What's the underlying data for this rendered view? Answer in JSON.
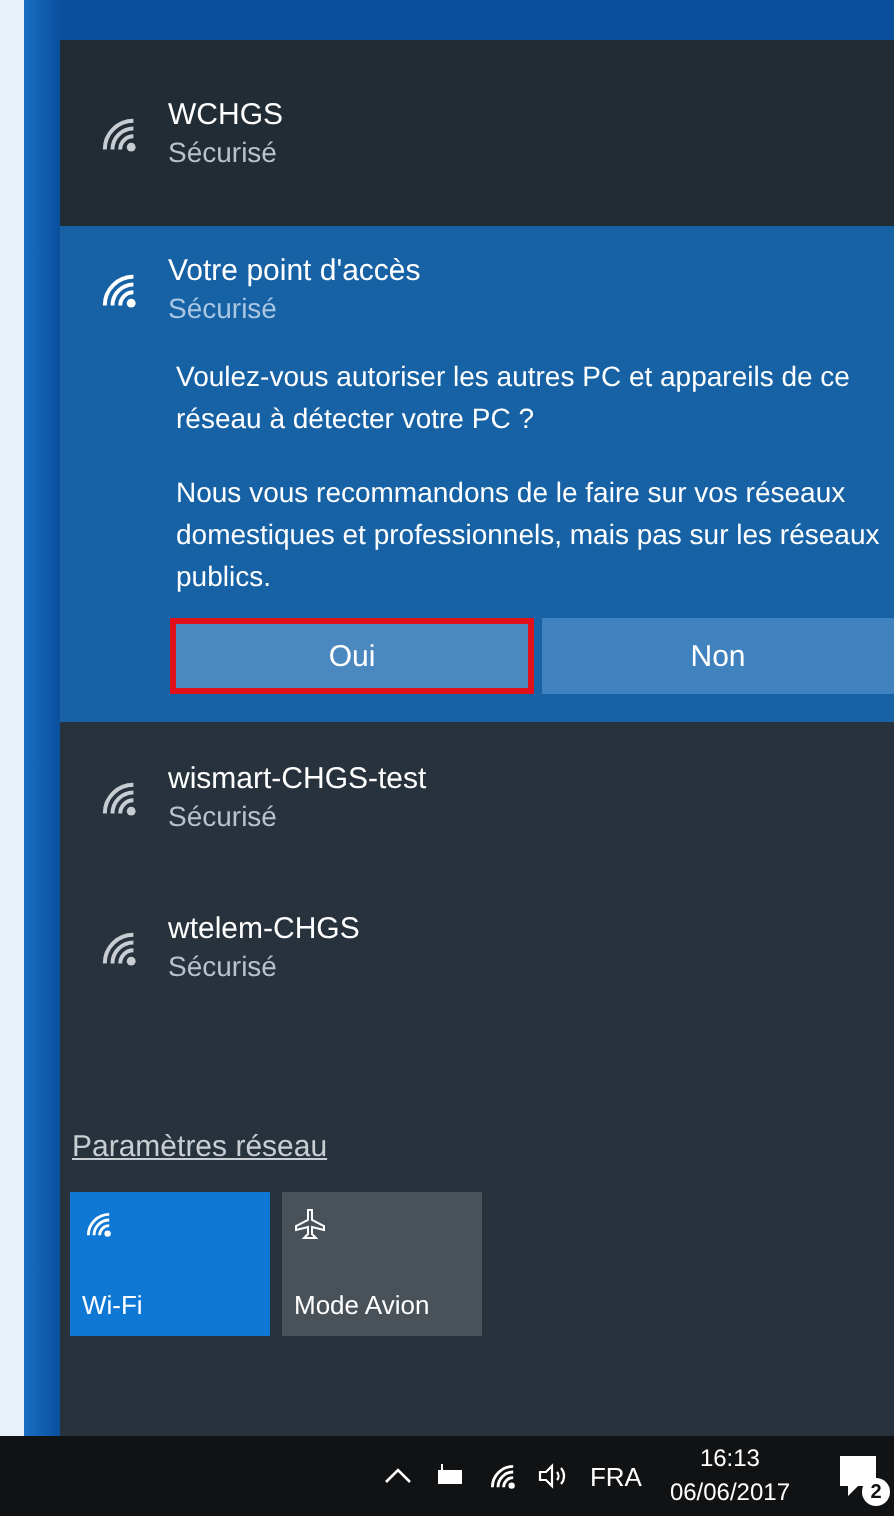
{
  "networks_top": [
    {
      "name": "WCHGS",
      "status": "Sécurisé",
      "selected": false
    }
  ],
  "selected_network": {
    "name": "Votre point d'accès",
    "status": "Sécurisé",
    "prompt": "Voulez-vous autoriser les autres PC et appareils de ce réseau à détecter votre PC ?",
    "advice": "Nous vous recommandons de le faire sur vos réseaux domestiques et professionnels, mais pas sur les réseaux publics.",
    "buttons": [
      {
        "label": "Oui",
        "highlighted": true
      },
      {
        "label": "Non",
        "highlighted": false
      }
    ]
  },
  "networks": [
    {
      "name": "wismart-CHGS-test",
      "status": "Sécurisé",
      "selected": false
    },
    {
      "name": "wtelem-CHGS",
      "status": "Sécurisé",
      "selected": false
    }
  ],
  "settings_link": "Paramètres réseau",
  "quick_actions": [
    {
      "label": "Wi-Fi",
      "kind": "wifi",
      "on": true
    },
    {
      "label": "Mode Avion",
      "kind": "airplane",
      "on": false
    }
  ],
  "taskbar": {
    "language": "FRA",
    "time": "16:13",
    "date": "06/06/2017",
    "notifications": "2"
  }
}
